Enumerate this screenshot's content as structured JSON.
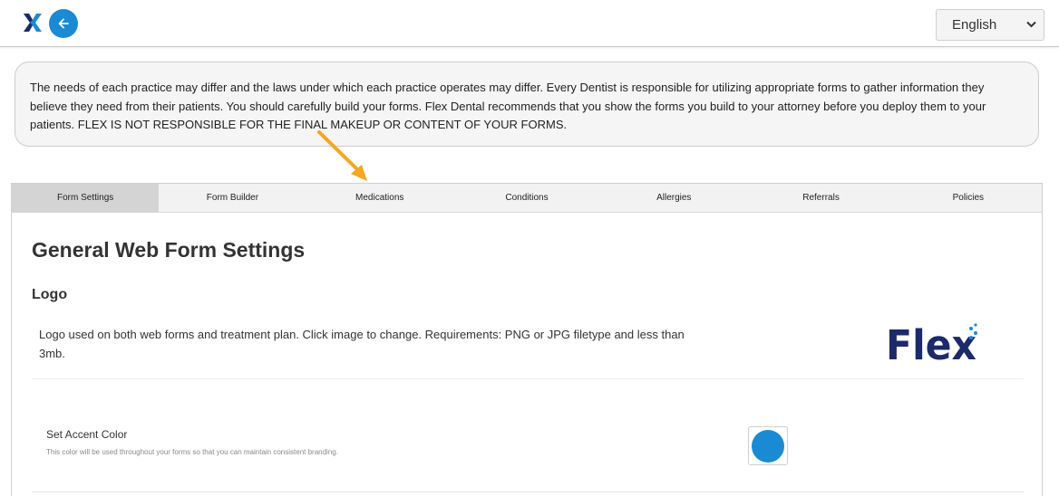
{
  "header": {
    "brand_icon": "flex-x-icon",
    "back_icon": "arrow-left-icon",
    "language": {
      "selected": "English",
      "icon": "chevron-down-icon"
    }
  },
  "notice": {
    "text": "The needs of each practice may differ and the laws under which each practice operates may differ.   Every Dentist is responsible for utilizing appropriate forms to gather information they believe they need from their patients.   You should carefully build your forms.   Flex Dental recommends that you show the forms you build to your attorney before you deploy them to your patients.   FLEX IS NOT RESPONSIBLE FOR THE FINAL MAKEUP OR CONTENT OF YOUR FORMS."
  },
  "tabs": [
    {
      "label": "Form Settings",
      "active": true
    },
    {
      "label": "Form Builder"
    },
    {
      "label": "Medications"
    },
    {
      "label": "Conditions"
    },
    {
      "label": "Allergies"
    },
    {
      "label": "Referrals"
    },
    {
      "label": "Policies"
    }
  ],
  "main": {
    "title": "General Web Form Settings",
    "logo_section": {
      "heading": "Logo",
      "description": "Logo used on both web forms and treatment plan. Click image to change. Requirements: PNG or JPG filetype and less than 3mb.",
      "logo_text": "Flex"
    },
    "accent": {
      "label": "Set Accent Color",
      "hint": "This color will be used throughout your forms so that you can maintain consistent branding.",
      "color": "#1a8ad4"
    }
  },
  "colors": {
    "accent": "#1a8ad4",
    "brand_navy": "#1c2a6b",
    "arrow": "#f5a623"
  }
}
